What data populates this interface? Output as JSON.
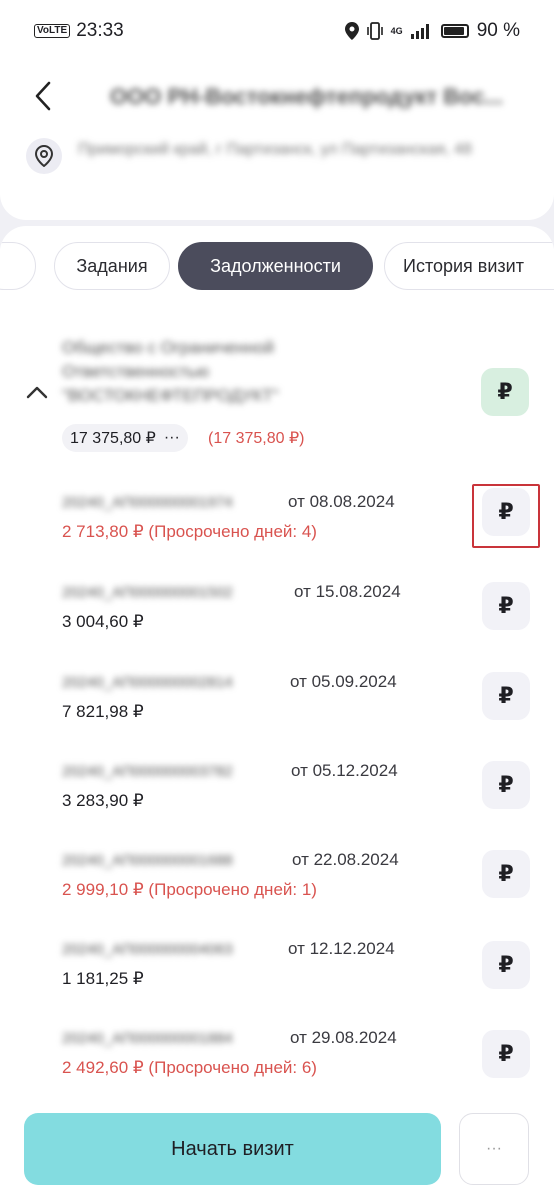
{
  "status_bar": {
    "time": "23:33",
    "volte": "VoLTE",
    "network": "4G",
    "battery": "90 %"
  },
  "header": {
    "org_name": "ООО РН-Востокнефтепродукт Вос...",
    "address": "Приморский край, г Партизанск, ул Партизанская, 48",
    "icons": {
      "back": "chevron-left-icon",
      "location": "location-pin-icon"
    }
  },
  "tabs": [
    {
      "label": "Задания",
      "active": false
    },
    {
      "label": "Задолженности",
      "active": true
    },
    {
      "label": "История визит",
      "active": false
    }
  ],
  "group": {
    "name": "Общество с Ограниченной Ответственностью \"ВОСТОКНЕФТЕПРОДУКТ\"",
    "total": "17 375,80 ₽",
    "more": "···",
    "overdue_total": "(17 375,80 ₽)",
    "ruble_symbol": "₽",
    "accent_color": "#d8efe0"
  },
  "debts": [
    {
      "doc": "20240_АП000000001974",
      "date": "от 08.08.2024",
      "amount": "2 713,80 ₽ (Просрочено дней: 4)",
      "overdue": true
    },
    {
      "doc": "20240_АП000000001502",
      "date": "от 15.08.2024",
      "amount": "3 004,60 ₽",
      "overdue": false
    },
    {
      "doc": "20240_АП000000002814",
      "date": "от 05.09.2024",
      "amount": "7 821,98 ₽",
      "overdue": false
    },
    {
      "doc": "20240_АП000000003782",
      "date": "от 05.12.2024",
      "amount": "3 283,90 ₽",
      "overdue": false
    },
    {
      "doc": "20240_АП000000001688",
      "date": "от 22.08.2024",
      "amount": "2 999,10 ₽ (Просрочено дней: 1)",
      "overdue": true
    },
    {
      "doc": "20240_АП000000004063",
      "date": "от 12.12.2024",
      "amount": "1 181,25 ₽",
      "overdue": false
    },
    {
      "doc": "20240_АП000000001884",
      "date": "от 29.08.2024",
      "amount": "2 492,60 ₽ (Просрочено дней: 6)",
      "overdue": true
    }
  ],
  "footer": {
    "start_visit": "Начать визит",
    "more": "···"
  },
  "colors": {
    "overdue": "#d9534f",
    "primary_button": "#83dce0",
    "active_tab": "#4b4c5c",
    "highlight": "#c9343a"
  }
}
